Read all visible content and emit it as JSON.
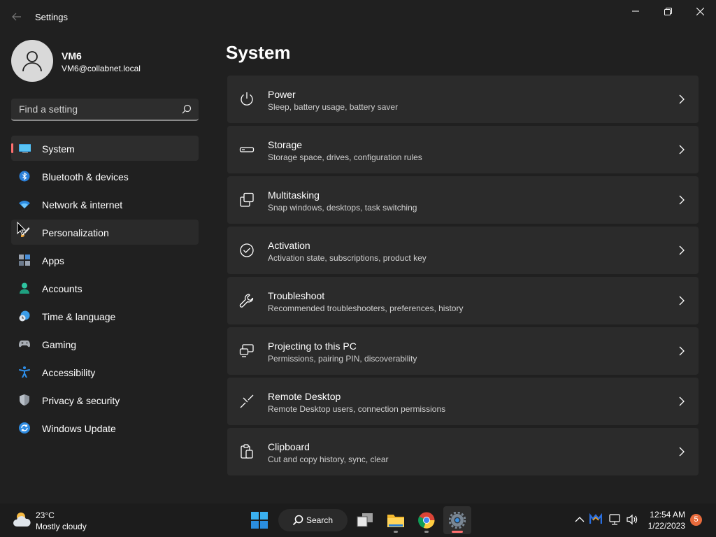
{
  "window": {
    "title": "Settings",
    "back_icon": "back-arrow-icon"
  },
  "profile": {
    "name": "VM6",
    "email": "VM6@collabnet.local"
  },
  "search": {
    "placeholder": "Find a setting",
    "value": ""
  },
  "sidebar": {
    "items": [
      {
        "label": "System",
        "icon": "system-display-icon",
        "active": true
      },
      {
        "label": "Bluetooth & devices",
        "icon": "bluetooth-icon"
      },
      {
        "label": "Network & internet",
        "icon": "wifi-icon"
      },
      {
        "label": "Personalization",
        "icon": "brush-icon"
      },
      {
        "label": "Apps",
        "icon": "apps-icon"
      },
      {
        "label": "Accounts",
        "icon": "person-icon"
      },
      {
        "label": "Time & language",
        "icon": "clock-globe-icon"
      },
      {
        "label": "Gaming",
        "icon": "gamepad-icon"
      },
      {
        "label": "Accessibility",
        "icon": "accessibility-icon"
      },
      {
        "label": "Privacy & security",
        "icon": "shield-icon"
      },
      {
        "label": "Windows Update",
        "icon": "update-icon"
      }
    ]
  },
  "main": {
    "title": "System",
    "cards": [
      {
        "title": "Power",
        "subtitle": "Sleep, battery usage, battery saver",
        "icon": "power-icon"
      },
      {
        "title": "Storage",
        "subtitle": "Storage space, drives, configuration rules",
        "icon": "storage-icon"
      },
      {
        "title": "Multitasking",
        "subtitle": "Snap windows, desktops, task switching",
        "icon": "multitasking-icon"
      },
      {
        "title": "Activation",
        "subtitle": "Activation state, subscriptions, product key",
        "icon": "activation-check-icon"
      },
      {
        "title": "Troubleshoot",
        "subtitle": "Recommended troubleshooters, preferences, history",
        "icon": "wrench-icon"
      },
      {
        "title": "Projecting to this PC",
        "subtitle": "Permissions, pairing PIN, discoverability",
        "icon": "projecting-icon"
      },
      {
        "title": "Remote Desktop",
        "subtitle": "Remote Desktop users, connection permissions",
        "icon": "remote-desktop-icon"
      },
      {
        "title": "Clipboard",
        "subtitle": "Cut and copy history, sync, clear",
        "icon": "clipboard-icon"
      }
    ]
  },
  "taskbar": {
    "weather": {
      "temp": "23°C",
      "desc": "Mostly cloudy"
    },
    "search_label": "Search",
    "clock": {
      "time": "12:54 AM",
      "date": "1/22/2023"
    },
    "notifications": "5"
  },
  "colors": {
    "accent": "#ff6f6f",
    "background": "#202020",
    "card": "#2b2b2b"
  }
}
